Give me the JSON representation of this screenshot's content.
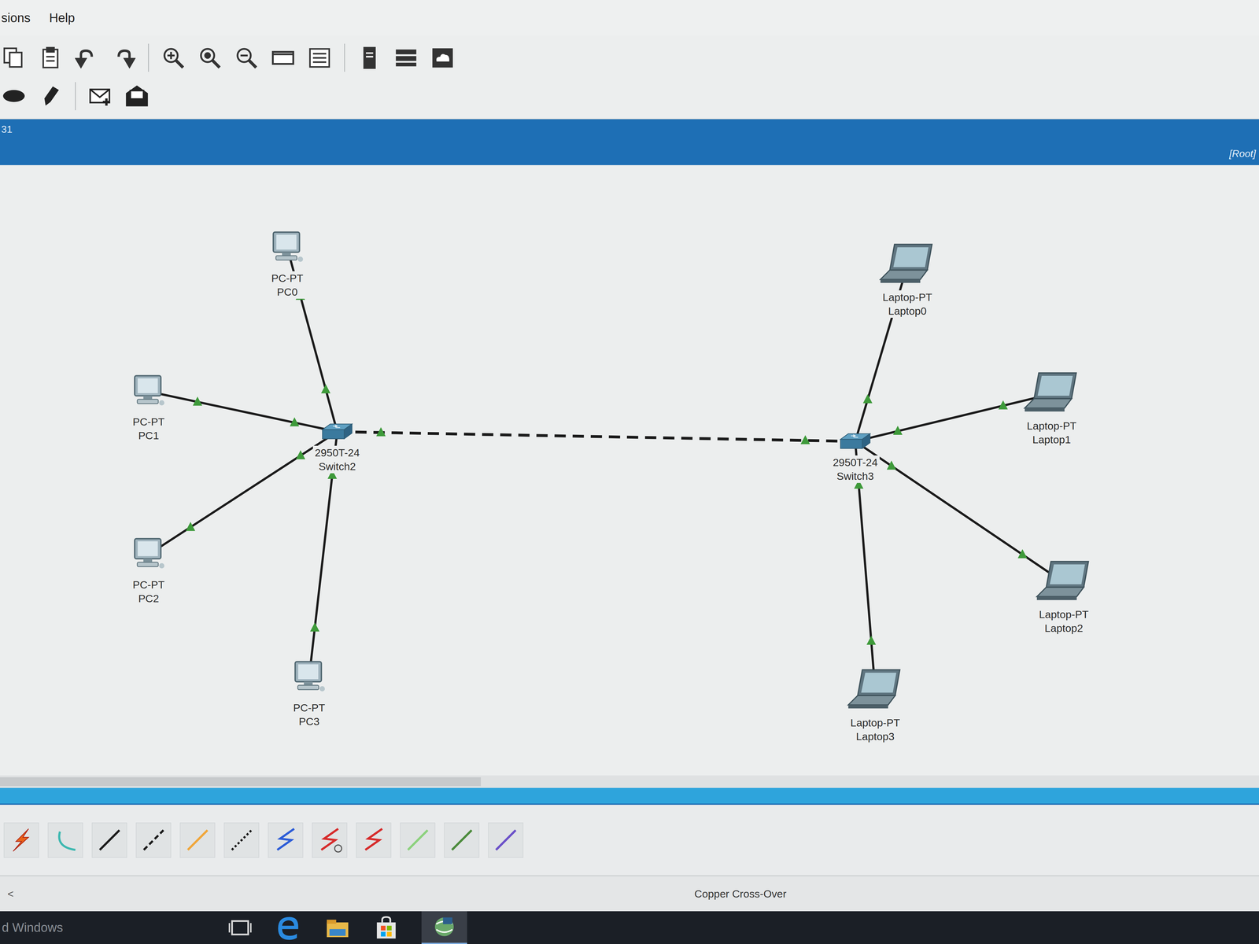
{
  "menu": [
    "sions",
    "Help"
  ],
  "workspace": {
    "label": "31",
    "path": "[Root]"
  },
  "devices": [
    {
      "model": "PC-PT",
      "name": "PC0",
      "kind": "pc"
    },
    {
      "model": "PC-PT",
      "name": "PC1",
      "kind": "pc"
    },
    {
      "model": "PC-PT",
      "name": "PC2",
      "kind": "pc"
    },
    {
      "model": "PC-PT",
      "name": "PC3",
      "kind": "pc"
    },
    {
      "model": "2950T-24",
      "name": "Switch2",
      "kind": "switch"
    },
    {
      "model": "2950T-24",
      "name": "Switch3",
      "kind": "switch"
    },
    {
      "model": "Laptop-PT",
      "name": "Laptop0",
      "kind": "laptop"
    },
    {
      "model": "Laptop-PT",
      "name": "Laptop1",
      "kind": "laptop"
    },
    {
      "model": "Laptop-PT",
      "name": "Laptop2",
      "kind": "laptop"
    },
    {
      "model": "Laptop-PT",
      "name": "Laptop3",
      "kind": "laptop"
    }
  ],
  "links": [
    {
      "from": "Switch2",
      "to": "PC0",
      "style": "solid",
      "up": true
    },
    {
      "from": "Switch2",
      "to": "PC1",
      "style": "solid",
      "up": true
    },
    {
      "from": "Switch2",
      "to": "PC2",
      "style": "solid",
      "up": true
    },
    {
      "from": "Switch2",
      "to": "PC3",
      "style": "solid",
      "up": true
    },
    {
      "from": "Switch2",
      "to": "Switch3",
      "style": "dashed",
      "up": true
    },
    {
      "from": "Switch3",
      "to": "Laptop0",
      "style": "solid",
      "up": true
    },
    {
      "from": "Switch3",
      "to": "Laptop1",
      "style": "solid",
      "up": true
    },
    {
      "from": "Switch3",
      "to": "Laptop2",
      "style": "solid",
      "up": true
    },
    {
      "from": "Switch3",
      "to": "Laptop3",
      "style": "solid",
      "up": true
    }
  ],
  "cables": [
    {
      "kind": "bolt",
      "color": "#e8631a"
    },
    {
      "kind": "curve",
      "color": "#3cb8b0"
    },
    {
      "kind": "line",
      "color": "#1a1a1a"
    },
    {
      "kind": "dashed",
      "color": "#1a1a1a"
    },
    {
      "kind": "line",
      "color": "#f0a63a"
    },
    {
      "kind": "dotted",
      "color": "#1a1a1a"
    },
    {
      "kind": "zigzag",
      "color": "#2a5bd7"
    },
    {
      "kind": "clock",
      "color": "#d62a2a"
    },
    {
      "kind": "zigzag",
      "color": "#d62a2a"
    },
    {
      "kind": "line",
      "color": "#8bd17c"
    },
    {
      "kind": "line",
      "color": "#4a8a3a"
    },
    {
      "kind": "line",
      "color": "#6a4fc8"
    }
  ],
  "scroll_arrow": "<",
  "status": "Copper Cross-Over",
  "taskbar": {
    "watermark": "d Windows"
  }
}
